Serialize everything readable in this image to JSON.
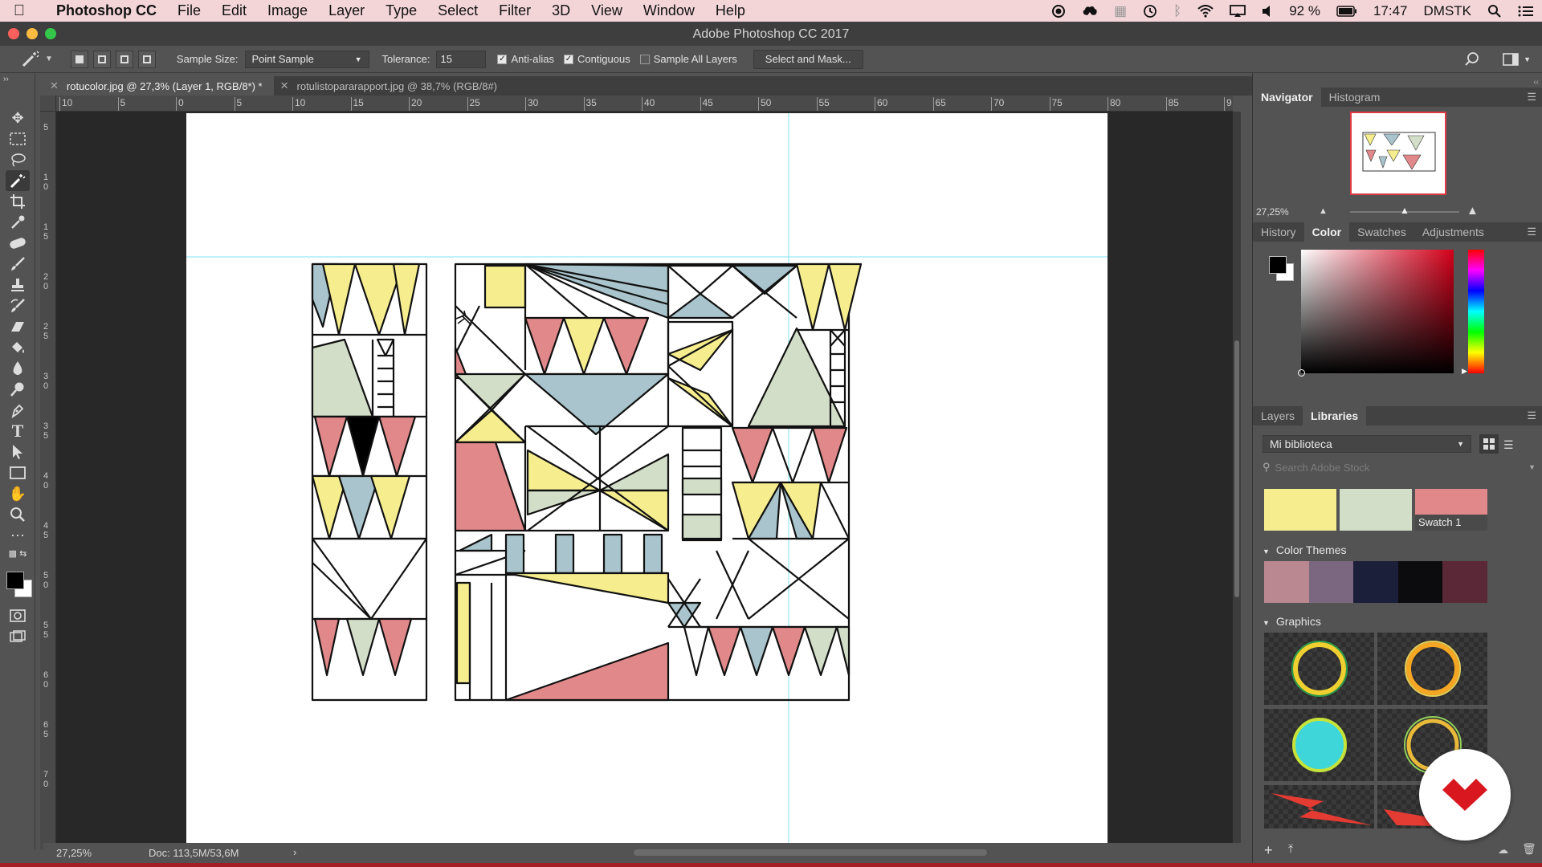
{
  "menubar": {
    "app_name": "Photoshop CC",
    "items": [
      "File",
      "Edit",
      "Image",
      "Layer",
      "Type",
      "Select",
      "Filter",
      "3D",
      "View",
      "Window",
      "Help"
    ],
    "battery": "92 %",
    "time": "17:47",
    "user": "DMSTK"
  },
  "window": {
    "title": "Adobe Photoshop CC 2017"
  },
  "options": {
    "sample_size_label": "Sample Size:",
    "sample_size_value": "Point Sample",
    "tolerance_label": "Tolerance:",
    "tolerance_value": "15",
    "anti_alias_label": "Anti-alias",
    "anti_alias_checked": true,
    "contiguous_label": "Contiguous",
    "contiguous_checked": true,
    "sample_all_layers_label": "Sample All Layers",
    "sample_all_layers_checked": false,
    "select_and_mask_label": "Select and Mask..."
  },
  "tabs": [
    {
      "label": "rotucolor.jpg @ 27,3% (Layer 1, RGB/8*) *",
      "active": true
    },
    {
      "label": "rotulistopararapport.jpg @ 38,7% (RGB/8#)",
      "active": false
    }
  ],
  "ruler": {
    "h_labels": [
      "10",
      "5",
      "0",
      "5",
      "10",
      "15",
      "20",
      "25",
      "30",
      "35",
      "40",
      "45",
      "50",
      "55",
      "60",
      "65",
      "70",
      "75",
      "80",
      "85",
      "9"
    ],
    "v_labels": [
      "5",
      "1 0",
      "1 5",
      "2 0",
      "2 5",
      "3 0",
      "3 5",
      "4 0",
      "4 5",
      "5 0",
      "5 5",
      "6 0",
      "6 5",
      "7 0"
    ]
  },
  "status": {
    "zoom": "27,25%",
    "doc": "Doc: 113,5M/53,6M"
  },
  "navigator": {
    "tabs": [
      "Navigator",
      "Histogram"
    ],
    "zoom": "27,25%"
  },
  "color_panel": {
    "tabs": [
      "History",
      "Color",
      "Swatches",
      "Adjustments"
    ],
    "active": "Color",
    "foreground": "#000000",
    "background": "#ffffff",
    "hue_color": "#d4001a"
  },
  "libraries": {
    "tabs": [
      "Layers",
      "Libraries"
    ],
    "active": "Libraries",
    "library_name": "Mi biblioteca",
    "search_placeholder": "Search Adobe Stock",
    "swatches": [
      {
        "color": "#f6ee8e",
        "label": ""
      },
      {
        "color": "#d3dec9",
        "label": ""
      },
      {
        "color": "#e1888a",
        "label": "Swatch 1"
      }
    ],
    "color_themes_label": "Color Themes",
    "color_theme": [
      "#b98890",
      "#7b6880",
      "#1b1f3a",
      "#0c0c0e",
      "#5a2837"
    ],
    "graphics_label": "Graphics"
  }
}
